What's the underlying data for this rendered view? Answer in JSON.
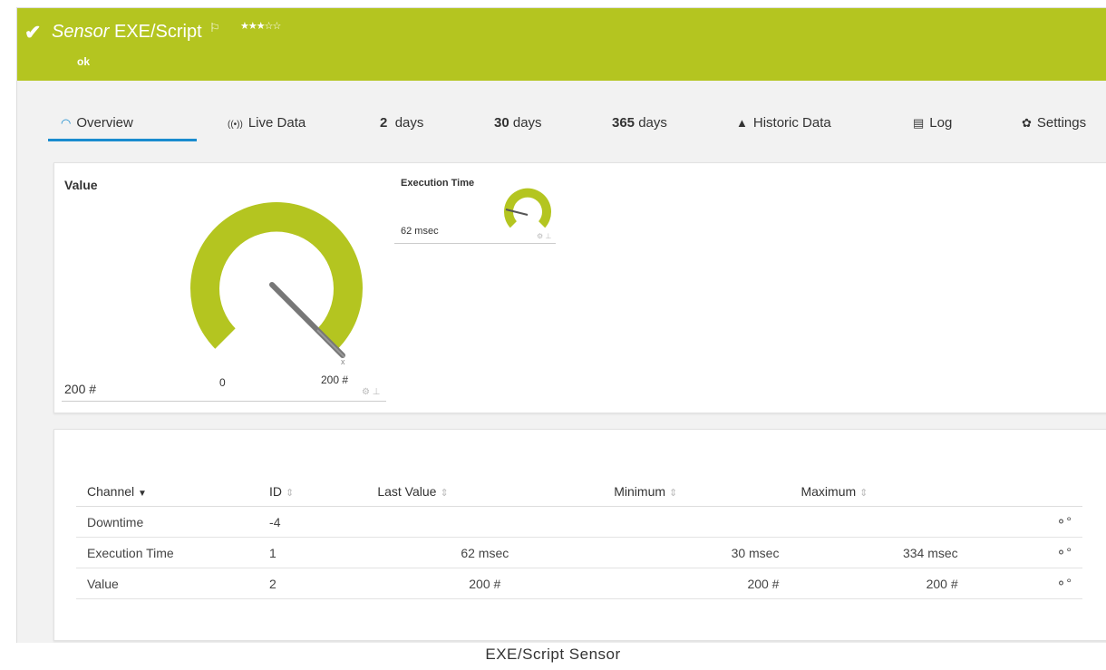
{
  "header": {
    "check_icon": "checkmark-icon",
    "title_prefix": "Sensor",
    "title_main": "EXE/Script",
    "flag_icon": "flag-icon",
    "stars": "★★★☆☆",
    "status": "ok",
    "bg_color": "#b4c520"
  },
  "tabs": [
    {
      "icon": "gauge-icon",
      "label": "Overview"
    },
    {
      "icon": "live-icon",
      "label": "Live Data"
    },
    {
      "num": "2",
      "label": "days"
    },
    {
      "num": "30",
      "label": "days"
    },
    {
      "num": "365",
      "label": "days"
    },
    {
      "icon": "chart-icon",
      "label": "Historic Data"
    },
    {
      "icon": "list-icon",
      "label": "Log"
    },
    {
      "icon": "gear-icon",
      "label": "Settings"
    }
  ],
  "gauges": {
    "value": {
      "title": "Value",
      "reading": "200 #",
      "min": "0",
      "max": "200 #",
      "fraction": 1.0
    },
    "execution": {
      "title": "Execution Time",
      "reading": "62 msec"
    }
  },
  "table": {
    "headers": [
      "Channel",
      "ID",
      "Last Value",
      "Minimum",
      "Maximum"
    ],
    "rows": [
      {
        "channel": "Downtime",
        "id": "-4",
        "last": "",
        "min": "",
        "max": ""
      },
      {
        "channel": "Execution Time",
        "id": "1",
        "last": "62 msec",
        "min": "30 msec",
        "max": "334 msec"
      },
      {
        "channel": "Value",
        "id": "2",
        "last": "200 #",
        "min": "200 #",
        "max": "200 #"
      }
    ]
  },
  "caption": "EXE/Script Sensor"
}
